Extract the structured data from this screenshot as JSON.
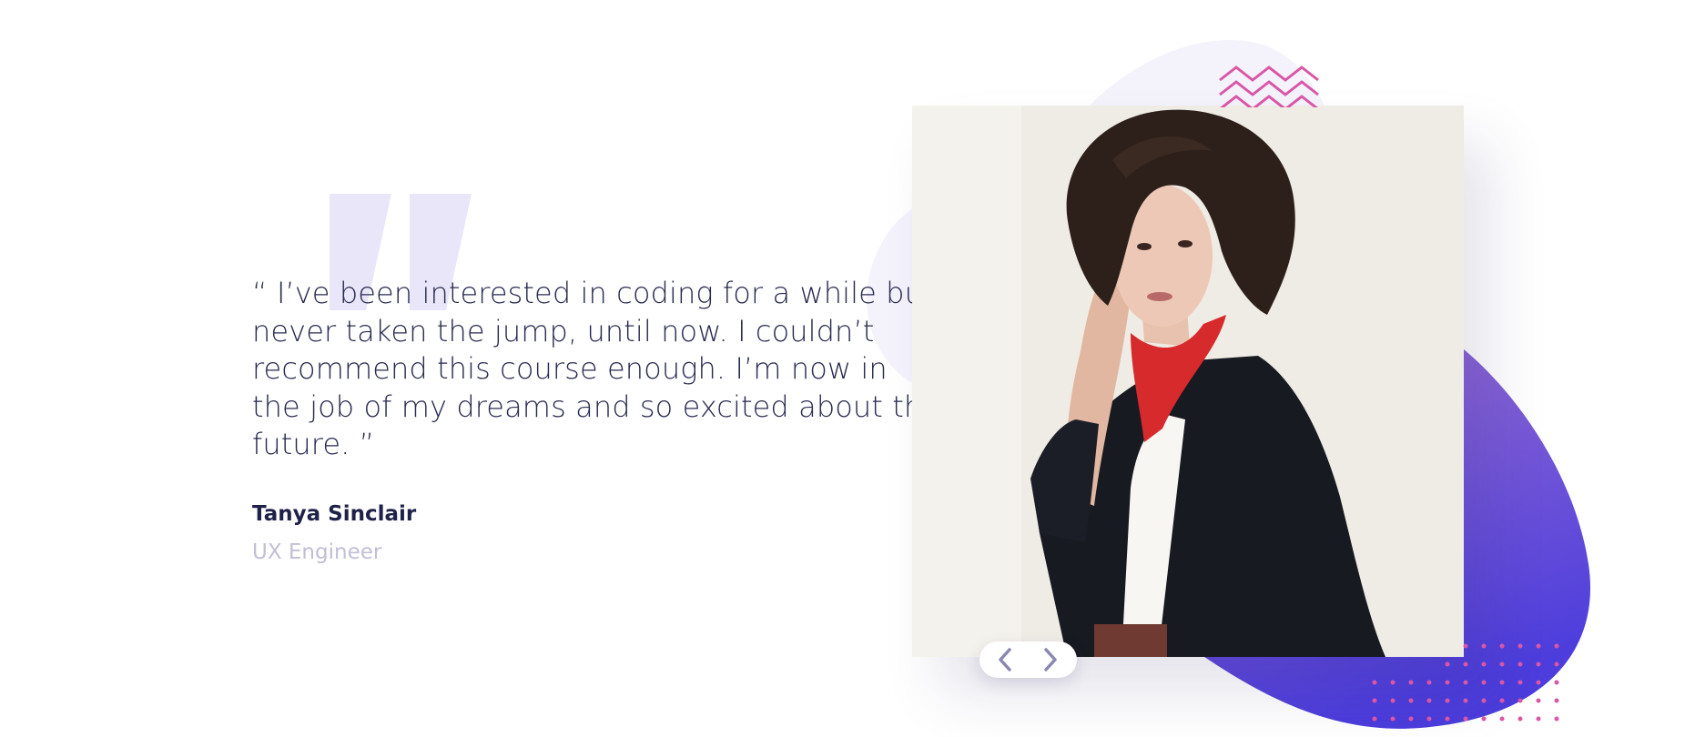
{
  "testimonial": {
    "quote": "“ I’ve been interested in coding for a while but never taken the jump, until now. I couldn’t recommend this course enough. I’m now in the job of my dreams and so excited about the future. ”",
    "author_name": "Tanya Sinclair",
    "author_role": "UX Engineer"
  },
  "photo": {
    "subject": "portrait of woman with curly hair"
  },
  "navigation": {
    "prev_icon": "chevron-left-icon",
    "next_icon": "chevron-right-icon"
  },
  "colors": {
    "text_primary": "#272B4F",
    "text_muted": "#C0BFD6",
    "accent_purple": "#6A4FD9",
    "accent_pink": "#D957A6",
    "quote_mark": "#E8E6F8"
  }
}
